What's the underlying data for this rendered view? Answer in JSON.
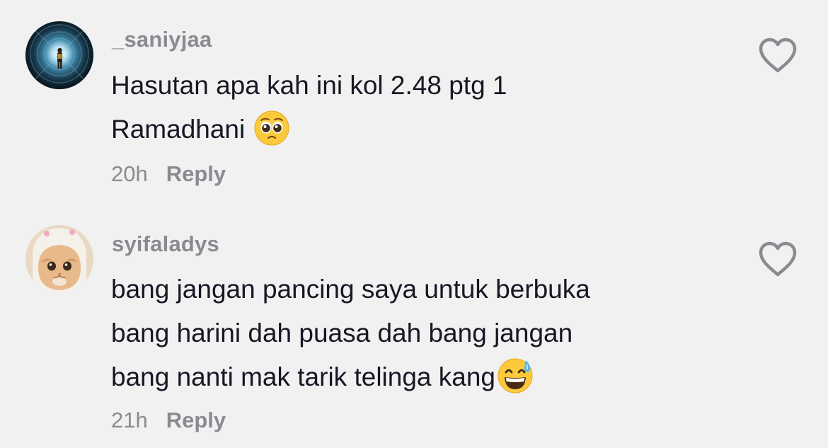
{
  "comments": [
    {
      "username": "_saniyjaa",
      "text_lines": [
        "Hasutan apa kah ini kol 2.48 ptg 1",
        "Ramadhani"
      ],
      "emoji": "pleading-face-emoji",
      "time": "20h",
      "reply_label": "Reply",
      "avatar": "tunnel-photo"
    },
    {
      "username": "syifaladys",
      "text_lines": [
        "bang jangan pancing saya untuk berbuka",
        "bang harini dah puasa dah bang jangan",
        "bang nanti mak tarik telinga kang"
      ],
      "emoji": "grinning-sweat-emoji",
      "time": "21h",
      "reply_label": "Reply",
      "avatar": "cat-photo"
    }
  ],
  "icons": {
    "like": "heart-outline-icon"
  },
  "colors": {
    "background": "#f1f1f2",
    "text": "#161823",
    "secondary": "#8a8b91"
  }
}
